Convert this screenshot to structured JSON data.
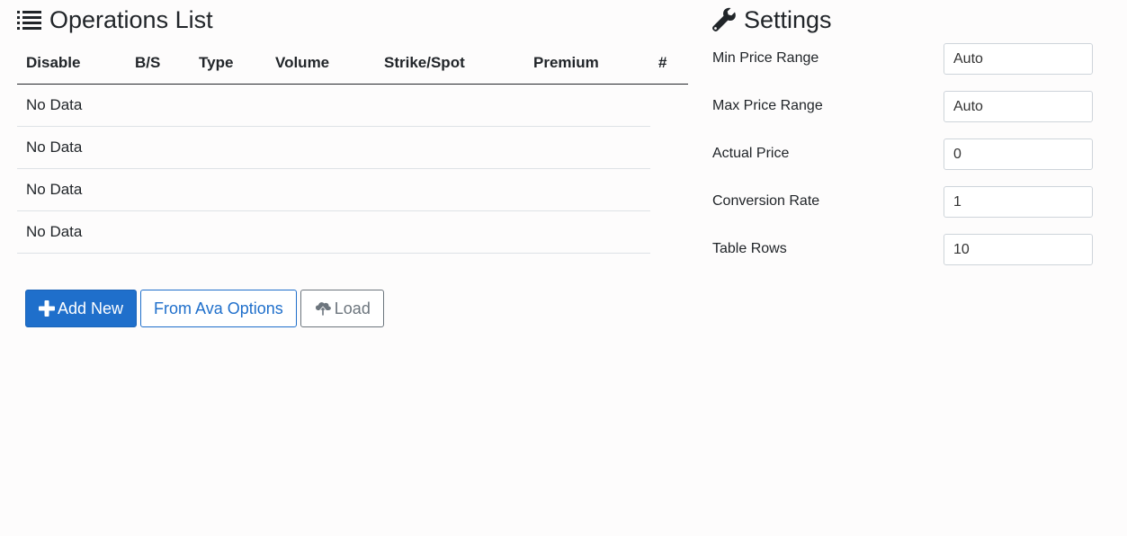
{
  "operations": {
    "title": "Operations List",
    "title_icon": "list-icon",
    "columns": [
      "Disable",
      "B/S",
      "Type",
      "Volume",
      "Strike/Spot",
      "Premium",
      "#"
    ],
    "rows": [
      "No Data",
      "No Data",
      "No Data",
      "No Data"
    ],
    "buttons": {
      "add_new": "Add New",
      "from_ava": "From Ava Options",
      "load": "Load"
    },
    "button_icons": {
      "add_new": "plus-icon",
      "load": "cloud-upload-icon"
    }
  },
  "settings": {
    "title": "Settings",
    "title_icon": "wrench-icon",
    "fields": [
      {
        "label": "Min Price Range",
        "value": "Auto"
      },
      {
        "label": "Max Price Range",
        "value": "Auto"
      },
      {
        "label": "Actual Price",
        "value": "0"
      },
      {
        "label": "Conversion Rate",
        "value": "1"
      },
      {
        "label": "Table Rows",
        "value": "10"
      }
    ]
  },
  "colors": {
    "primary": "#1f6fcb",
    "secondary": "#6c757d",
    "text": "#212529",
    "background": "#fdfcfc"
  }
}
